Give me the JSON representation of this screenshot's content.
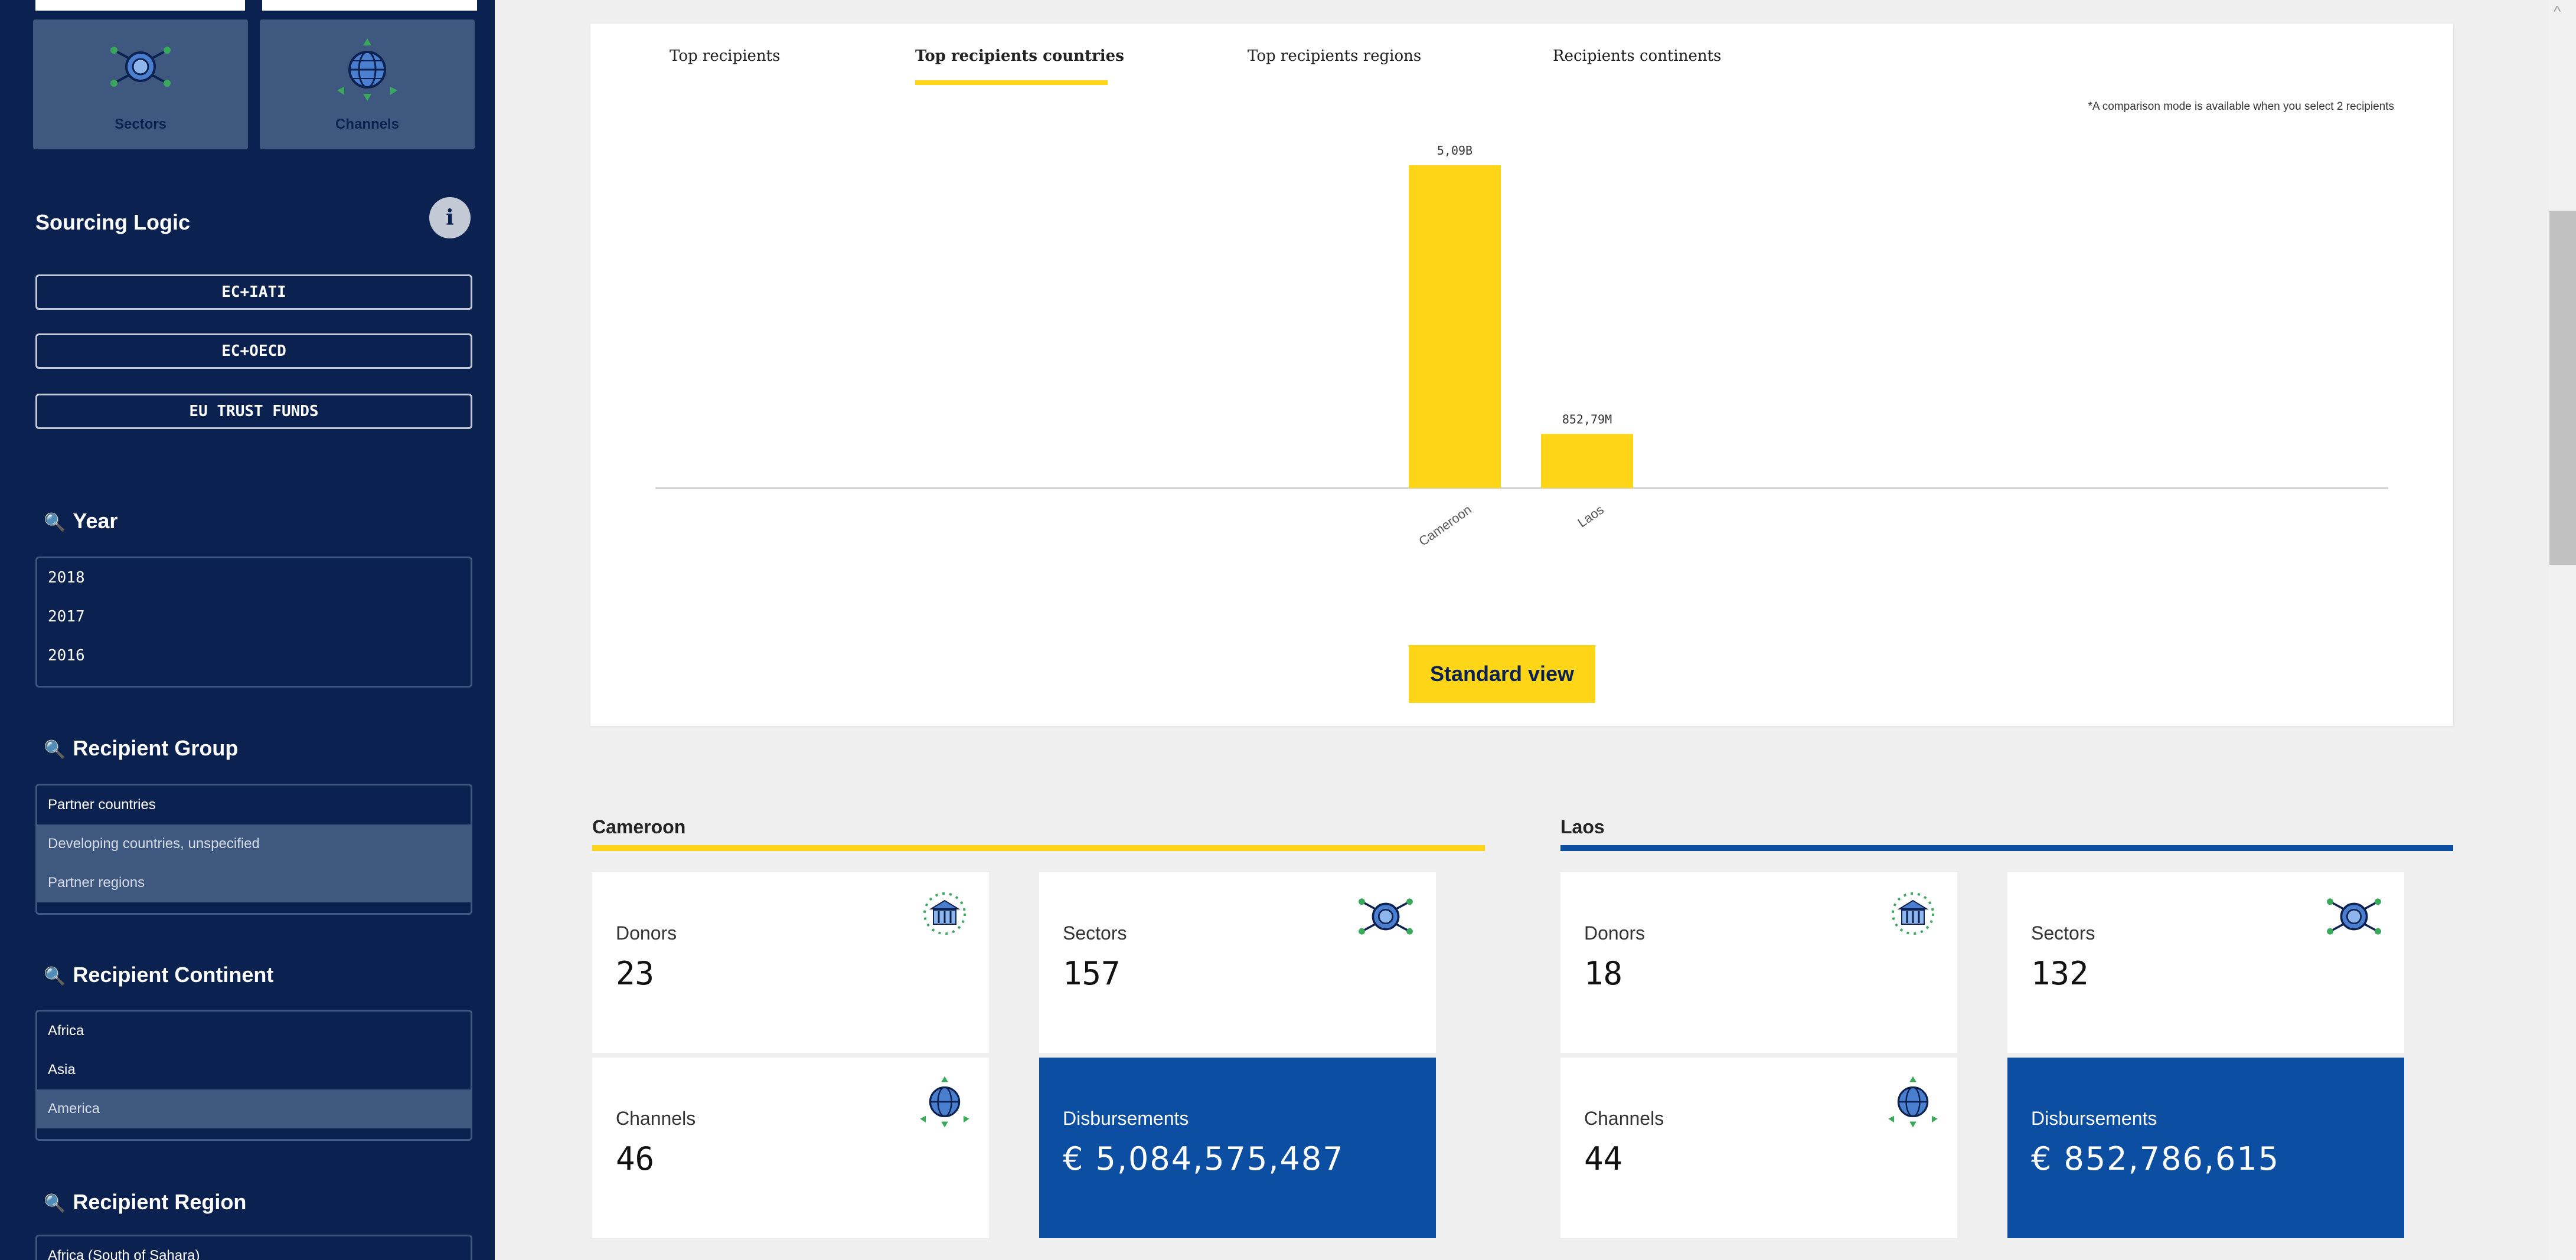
{
  "sidebar": {
    "tiles": [
      {
        "label": "Sectors",
        "icon": "sectors-icon"
      },
      {
        "label": "Channels",
        "icon": "channels-icon"
      }
    ],
    "sourcing": {
      "title": "Sourcing Logic",
      "info_icon": "i",
      "buttons": [
        "EC+IATI",
        "EC+OECD",
        "EU TRUST FUNDS"
      ]
    },
    "search_icon": "🔍",
    "filters": {
      "year": {
        "title": "Year",
        "options": [
          "2018",
          "2017",
          "2016"
        ]
      },
      "recipient_group": {
        "title": "Recipient Group",
        "options": [
          "Partner countries",
          "Developing countries, unspecified",
          "Partner regions"
        ]
      },
      "recipient_continent": {
        "title": "Recipient Continent",
        "options": [
          "Africa",
          "Asia",
          "America"
        ]
      },
      "recipient_region": {
        "title": "Recipient Region",
        "options": [
          "Africa (South of Sahara)"
        ]
      }
    }
  },
  "chart_panel": {
    "tabs": [
      "Top recipients",
      "Top recipients countries",
      "Top recipients regions",
      "Recipients continents"
    ],
    "active_tab": "Top recipients countries",
    "comparison_note": "*A comparison mode is available when you select 2 recipients",
    "standard_view_label": "Standard view"
  },
  "chart_data": {
    "type": "bar",
    "categories": [
      "Cameroon",
      "Laos"
    ],
    "values": [
      5084575487,
      852786615
    ],
    "data_labels": [
      "5,09B",
      "852,79M"
    ],
    "color": "#ffd617"
  },
  "countries": [
    {
      "name": "Cameroon",
      "accent": "#ffd617",
      "donors_label": "Donors",
      "donors": "23",
      "sectors_label": "Sectors",
      "sectors": "157",
      "channels_label": "Channels",
      "channels": "46",
      "disbursements_label": "Disbursements",
      "disbursements": "€ 5,084,575,487"
    },
    {
      "name": "Laos",
      "accent": "#0b4ea2",
      "donors_label": "Donors",
      "donors": "18",
      "sectors_label": "Sectors",
      "sectors": "132",
      "channels_label": "Channels",
      "channels": "44",
      "disbursements_label": "Disbursements",
      "disbursements": "€ 852,786,615"
    }
  ],
  "scrollbar": {
    "up_arrow": "^"
  }
}
